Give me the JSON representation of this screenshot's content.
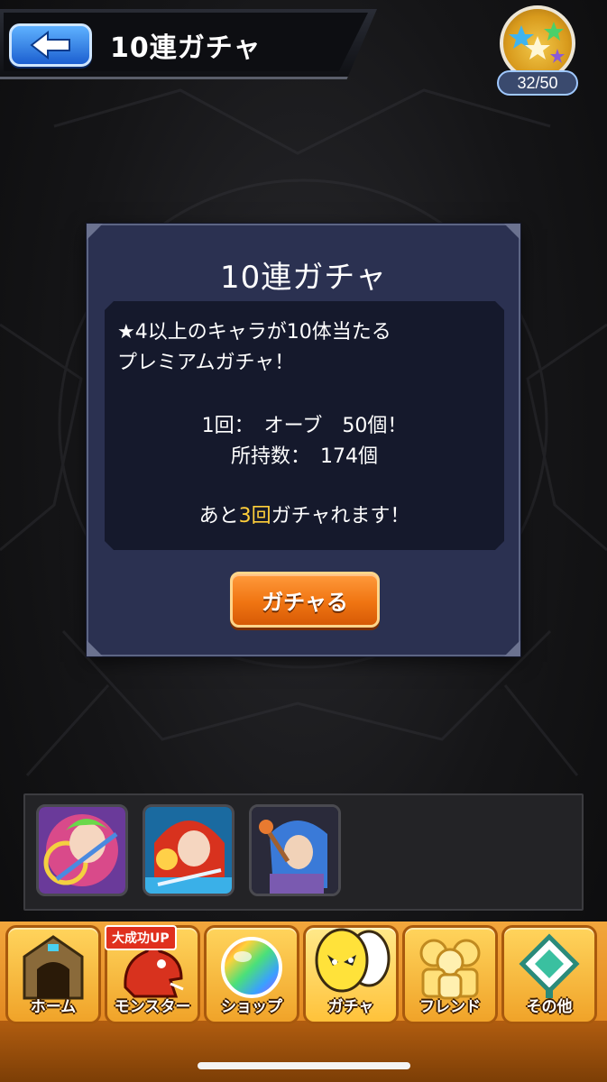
{
  "header": {
    "title": "10連ガチャ",
    "back_icon": "arrow-left-icon",
    "rank_counter": "32/50",
    "rank_icon": "star-medal-icon"
  },
  "dialog": {
    "title": "10連ガチャ",
    "description_line1": "★4以上のキャラが10体当たる",
    "description_line2": "プレミアムガチャ！",
    "cost_line": "1回：　オーブ　50個！",
    "owned_line": "所持数：　174個",
    "remaining_prefix": "あと",
    "remaining_count": "3回",
    "remaining_suffix": "ガチャれます！",
    "button_label": "ガチャる"
  },
  "party": {
    "slots": [
      {
        "icon": "monster-portrait-pink-hair-icon"
      },
      {
        "icon": "monster-portrait-red-hair-icon"
      },
      {
        "icon": "monster-portrait-blue-hair-icon"
      }
    ]
  },
  "nav": {
    "promo_badge": "大成功UP",
    "items": [
      {
        "label": "ホーム",
        "icon": "home-gate-icon"
      },
      {
        "label": "モンスター",
        "icon": "red-dragon-icon"
      },
      {
        "label": "ショップ",
        "icon": "rainbow-orb-icon"
      },
      {
        "label": "ガチャ",
        "icon": "yellow-egg-icon"
      },
      {
        "label": "フレンド",
        "icon": "friends-icon"
      },
      {
        "label": "その他",
        "icon": "other-menu-icon"
      }
    ],
    "active_index": 3
  },
  "colors": {
    "accent_orange": "#f07512",
    "highlight_yellow": "#ffcf3a",
    "dialog_bg": "#2b3151",
    "back_button_blue": "#1c5fd0"
  }
}
